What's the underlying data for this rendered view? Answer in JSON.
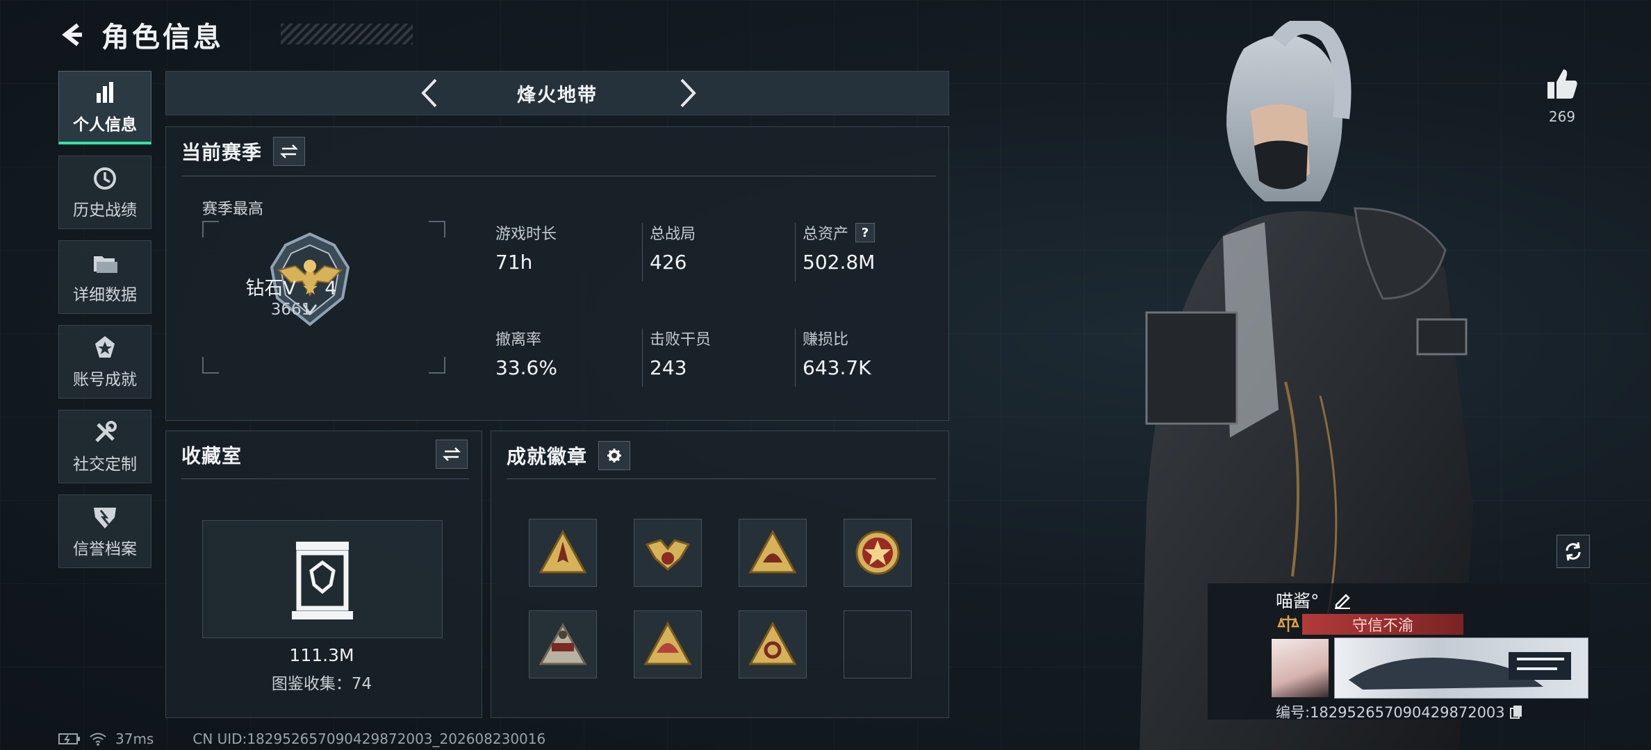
{
  "header": {
    "title": "角色信息"
  },
  "sidebar": {
    "items": [
      {
        "label": "个人信息",
        "icon": "bar-chart-icon",
        "active": true
      },
      {
        "label": "历史战绩",
        "icon": "history-icon"
      },
      {
        "label": "详细数据",
        "icon": "folder-icon"
      },
      {
        "label": "账号成就",
        "icon": "achievement-icon"
      },
      {
        "label": "社交定制",
        "icon": "tools-icon"
      },
      {
        "label": "信誉档案",
        "icon": "reputation-icon"
      }
    ]
  },
  "mode": {
    "name": "烽火地带"
  },
  "season": {
    "title": "当前赛季",
    "sub_label": "赛季最高",
    "rank_name": "钻石V",
    "rank_stars": "4",
    "rank_score": "3661",
    "stats": [
      {
        "label": "游戏时长",
        "value": "71h"
      },
      {
        "label": "总战局",
        "value": "426"
      },
      {
        "label": "总资产",
        "value": "502.8M",
        "help": "?"
      },
      {
        "label": "撤离率",
        "value": "33.6%"
      },
      {
        "label": "击败干员",
        "value": "243"
      },
      {
        "label": "赚损比",
        "value": "643.7K"
      }
    ]
  },
  "collection": {
    "title": "收藏室",
    "value": "111.3M",
    "count_text": "图鉴收集：74"
  },
  "achievements": {
    "title": "成就徽章",
    "badges": [
      "rocket-badge-icon",
      "eagle-badge-icon",
      "helmet-badge-icon",
      "star-medal-icon",
      "drone-badge-icon",
      "helmet-triangle-badge-icon",
      "gear-triangle-badge-icon",
      "empty-slot"
    ]
  },
  "likes": {
    "count": "269"
  },
  "player_card": {
    "name": "喵酱°",
    "title": "守信不渝",
    "id_text": "编号:182952657090429872003"
  },
  "footer": {
    "ping": "37ms",
    "uid": "CN UID:182952657090429872003_202608230016"
  },
  "colors": {
    "accent": "#2ee6a3",
    "title_red": "#b23a3a",
    "gold": "#c9a24a"
  }
}
